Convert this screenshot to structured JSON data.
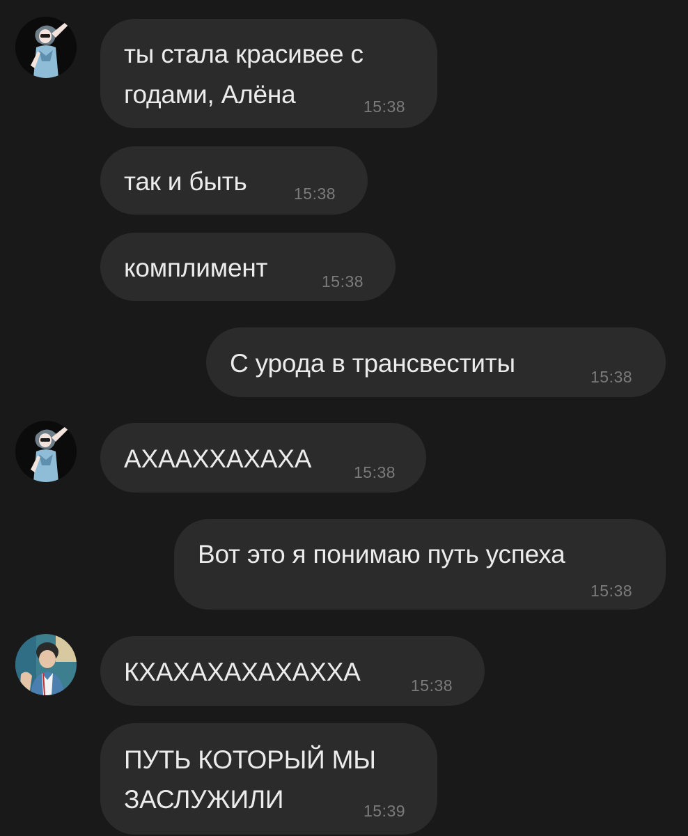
{
  "messages": [
    {
      "text_lines": [
        "ты стала красивее с",
        "годами, Алёна"
      ],
      "time": "15:38",
      "side": "in",
      "sender": "girl"
    },
    {
      "text_lines": [
        "так и быть"
      ],
      "time": "15:38",
      "side": "in"
    },
    {
      "text_lines": [
        "комплимент"
      ],
      "time": "15:38",
      "side": "in"
    },
    {
      "text_lines": [
        "С урода в трансвеститы"
      ],
      "time": "15:38",
      "side": "out"
    },
    {
      "text_lines": [
        "АХААХХАХАХА"
      ],
      "time": "15:38",
      "side": "in",
      "sender": "girl"
    },
    {
      "text_lines": [
        "Вот это я понимаю путь успеха"
      ],
      "time": "15:38",
      "side": "out"
    },
    {
      "text_lines": [
        "КХАХАХАХАХАХХА"
      ],
      "time": "15:38",
      "side": "in",
      "sender": "boy"
    },
    {
      "text_lines": [
        "ПУТЬ КОТОРЫЙ МЫ",
        "ЗАСЛУЖИЛИ"
      ],
      "time": "15:39",
      "side": "in"
    }
  ],
  "colors": {
    "background": "#191919",
    "bubble": "#2b2b2b",
    "text": "#ececec",
    "time": "#7b7b7b"
  }
}
